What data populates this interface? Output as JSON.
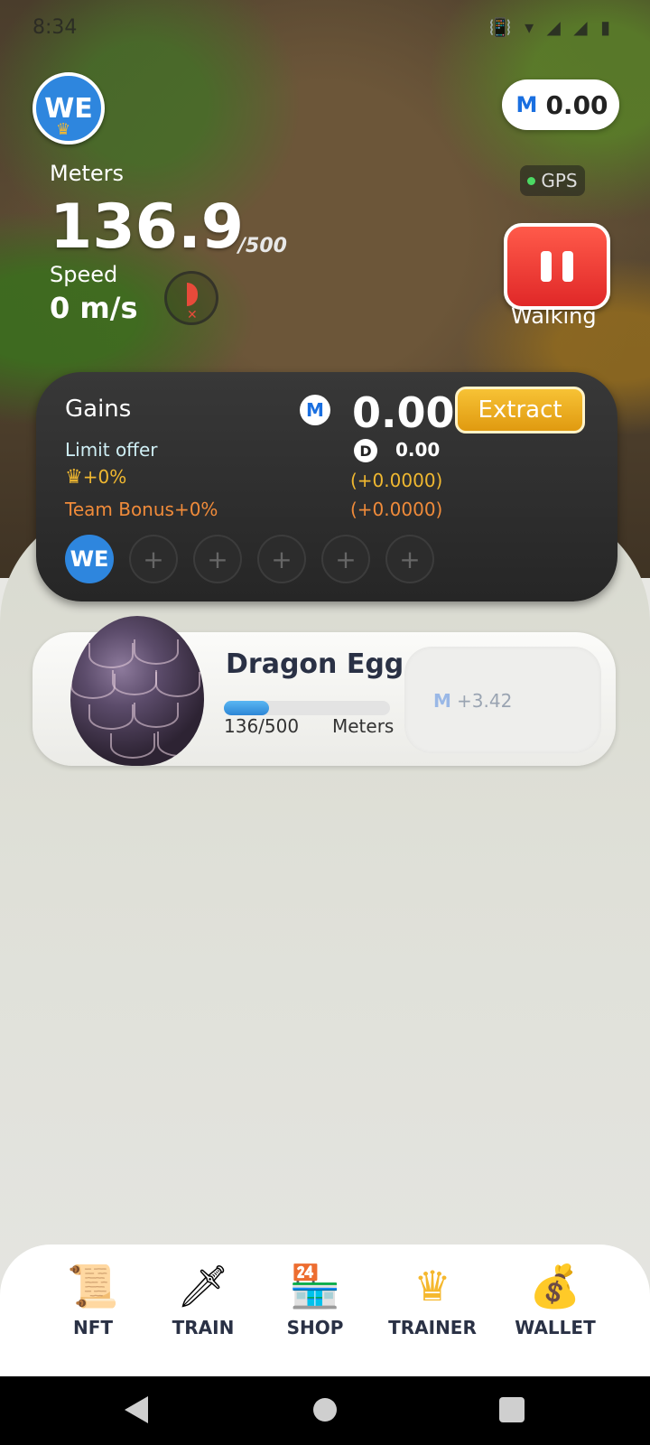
{
  "status_bar": {
    "time": "8:34",
    "icons": "📳 ▾ ◢ ◢ ▮"
  },
  "header": {
    "avatar_text": "WE",
    "balance_icon": "M",
    "balance": "0.00",
    "gps_label": "GPS"
  },
  "stats": {
    "meters_label": "Meters",
    "meters_value": "136.9",
    "meters_goal": "/500",
    "speed_label": "Speed",
    "speed_value": "0 m/s",
    "walking_label": "Walking"
  },
  "gains": {
    "title": "Gains",
    "m_icon": "M",
    "value": "0.00",
    "extract_label": "Extract",
    "limit_offer": "Limit offer",
    "d_icon": "D",
    "d_value": "0.00",
    "crown_bonus": "+0%",
    "crown_extra": "(+0.0000)",
    "team_bonus": "Team Bonus+0%",
    "team_extra": "(+0.0000)",
    "slot_first": "WE",
    "slot_add": "+"
  },
  "egg": {
    "title": "Dragon Egg",
    "progress_text": "136/500",
    "progress_fraction": 0.272,
    "unit": "Meters",
    "reward_icon": "M",
    "reward": "+3.42"
  },
  "nav": {
    "items": [
      {
        "label": "NFT",
        "icon": "scroll-certificate-icon"
      },
      {
        "label": "TRAIN",
        "icon": "sword-icon"
      },
      {
        "label": "SHOP",
        "icon": "shop-icon"
      },
      {
        "label": "TRAINER",
        "icon": "crown-icon"
      },
      {
        "label": "WALLET",
        "icon": "coin-bag-icon"
      }
    ]
  },
  "colors": {
    "accent": "#2e86de",
    "pause": "#e02828",
    "extract": "#f0b020"
  }
}
